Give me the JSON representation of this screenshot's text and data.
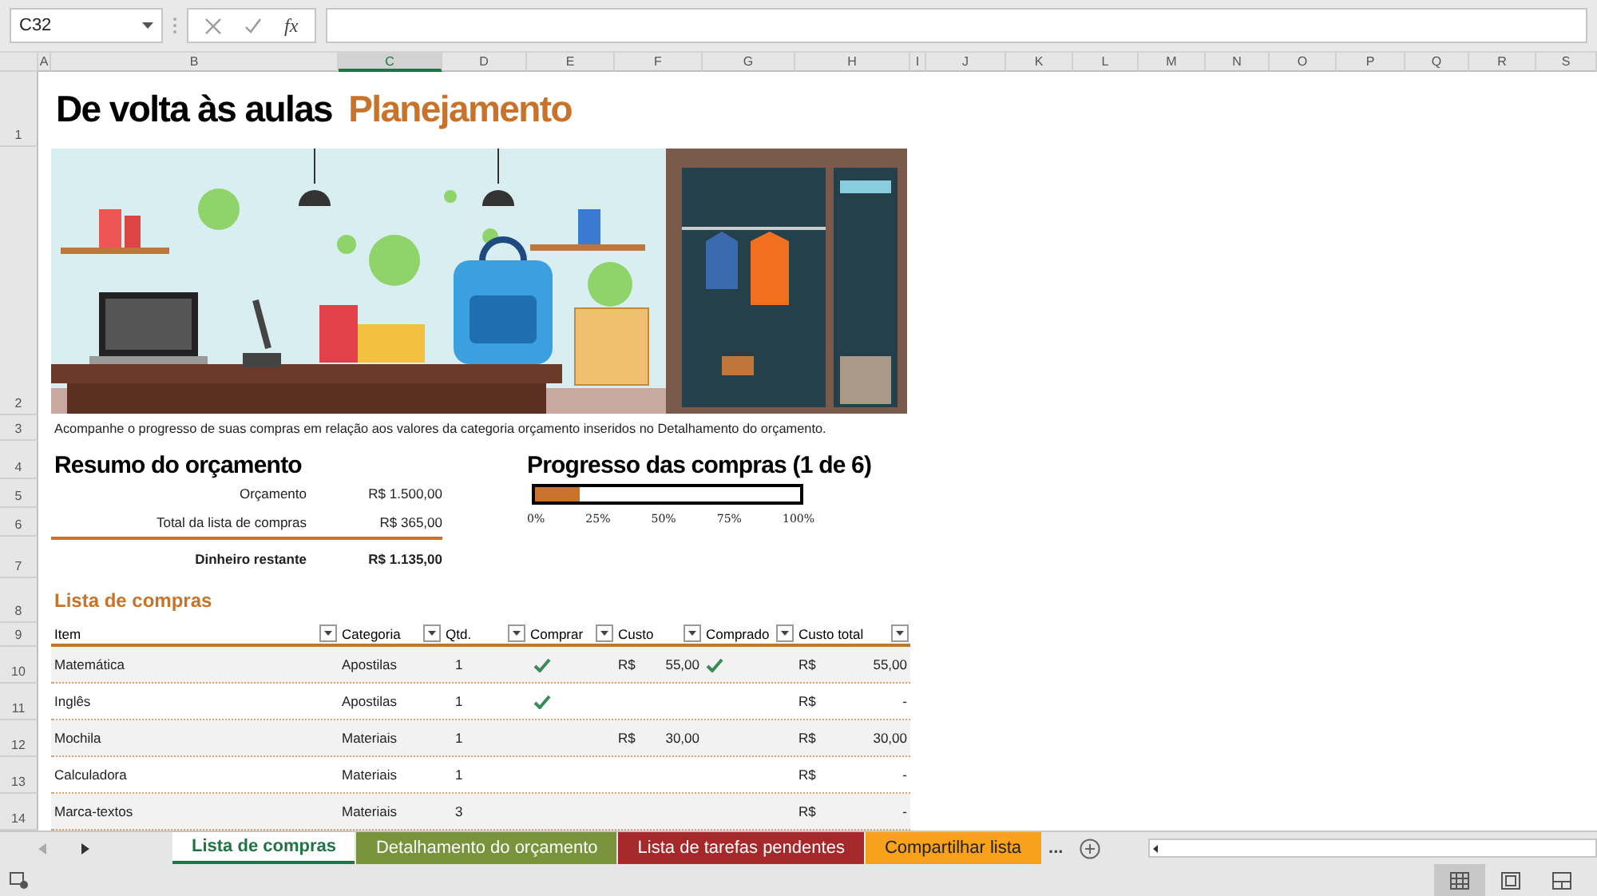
{
  "formula_bar": {
    "name_box": "C32",
    "function_label": "fx"
  },
  "columns": [
    {
      "label": "A",
      "selected": false
    },
    {
      "label": "B",
      "selected": false
    },
    {
      "label": "C",
      "selected": true
    },
    {
      "label": "D",
      "selected": false
    },
    {
      "label": "E",
      "selected": false
    },
    {
      "label": "F",
      "selected": false
    },
    {
      "label": "G",
      "selected": false
    },
    {
      "label": "H",
      "selected": false
    },
    {
      "label": "I",
      "selected": false
    },
    {
      "label": "J",
      "selected": false
    },
    {
      "label": "K",
      "selected": false
    },
    {
      "label": "L",
      "selected": false
    },
    {
      "label": "M",
      "selected": false
    },
    {
      "label": "N",
      "selected": false
    },
    {
      "label": "O",
      "selected": false
    },
    {
      "label": "P",
      "selected": false
    },
    {
      "label": "Q",
      "selected": false
    },
    {
      "label": "R",
      "selected": false
    },
    {
      "label": "S",
      "selected": false
    }
  ],
  "row_numbers": [
    "1",
    "2",
    "3",
    "4",
    "5",
    "6",
    "7",
    "8",
    "9",
    "10",
    "11",
    "12",
    "13",
    "14"
  ],
  "title": {
    "main": "De volta às aulas",
    "accent": "Planejamento"
  },
  "description": "Acompanhe o progresso de suas compras em relação aos valores da categoria orçamento inseridos no Detalhamento do orçamento.",
  "budget_summary": {
    "heading": "Resumo do orçamento",
    "lines": [
      {
        "label": "Orçamento",
        "value": "R$ 1.500,00",
        "kind": "plain"
      },
      {
        "label": "Total da lista de compras",
        "value": "R$ 365,00",
        "kind": "plain"
      },
      {
        "label": "Dinheiro restante",
        "value": "R$ 1.135,00",
        "kind": "total"
      }
    ]
  },
  "progress": {
    "heading": "Progresso das compras (1 de 6)",
    "level": 0.17,
    "ticks": [
      "0%",
      "25%",
      "50%",
      "75%",
      "100%"
    ]
  },
  "shopping_list": {
    "heading": "Lista de compras",
    "columns": [
      "Item",
      "Categoria",
      "Qtd.",
      "Comprar",
      "Custo",
      "Comprado",
      "Custo total"
    ],
    "rows": [
      {
        "item": "Matemática",
        "category": "Apostilas",
        "qty": "1",
        "buy": true,
        "cost": {
          "currency": "R$",
          "amount": "55,00"
        },
        "bought": true,
        "total": {
          "currency": "R$",
          "amount": "55,00"
        }
      },
      {
        "item": "Inglês",
        "category": "Apostilas",
        "qty": "1",
        "buy": true,
        "bought": false,
        "total": {
          "currency": "R$",
          "amount": "-"
        }
      },
      {
        "item": "Mochila",
        "category": "Materiais",
        "qty": "1",
        "buy": false,
        "cost": {
          "currency": "R$",
          "amount": "30,00"
        },
        "bought": false,
        "total": {
          "currency": "R$",
          "amount": "30,00"
        }
      },
      {
        "item": "Calculadora",
        "category": "Materiais",
        "qty": "1",
        "buy": false,
        "bought": false,
        "total": {
          "currency": "R$",
          "amount": "-"
        }
      },
      {
        "item": "Marca-textos",
        "category": "Materiais",
        "qty": "3",
        "buy": false,
        "bought": false,
        "total": {
          "currency": "R$",
          "amount": "-"
        }
      }
    ]
  },
  "sheet_tabs": [
    {
      "label": "Lista de compras",
      "selected": true,
      "color": "#ffffff"
    },
    {
      "label": "Detalhamento do orçamento",
      "selected": false,
      "color": "#77933c"
    },
    {
      "label": "Lista de tarefas pendentes",
      "selected": false,
      "color": "#a5282a"
    },
    {
      "label": "Compartilhar lista",
      "selected": false,
      "color": "#f7a11c"
    }
  ],
  "more_tabs": "...",
  "views": [
    {
      "kind": "normal",
      "selected": true
    },
    {
      "kind": "layout",
      "selected": false
    },
    {
      "kind": "pagebreak",
      "selected": false
    }
  ]
}
